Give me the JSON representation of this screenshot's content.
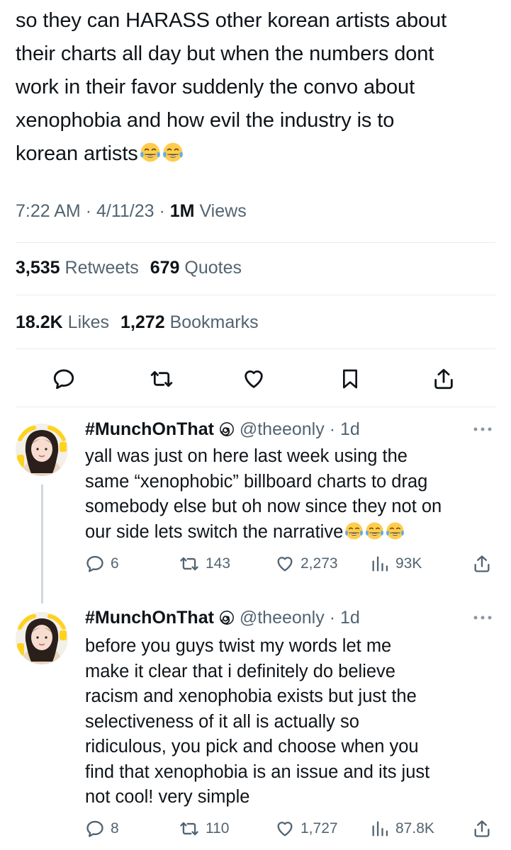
{
  "main_tweet": {
    "text": "so they can HARASS other korean artists about\ntheir charts all day but when the numbers dont\nwork in their favor suddenly the convo about\nxenophobia and how evil the industry is to\nkorean artists",
    "time": "7:22 AM",
    "date": "4/11/23",
    "views_count": "1M",
    "views_label": "Views",
    "retweets_count": "3,535",
    "retweets_label": "Retweets",
    "quotes_count": "679",
    "quotes_label": "Quotes",
    "likes_count": "18.2K",
    "likes_label": "Likes",
    "bookmarks_count": "1,272",
    "bookmarks_label": "Bookmarks",
    "actions": [
      "reply-icon",
      "retweet-icon",
      "like-icon",
      "bookmark-icon",
      "share-icon"
    ]
  },
  "replies": [
    {
      "name": "#MunchOnThat",
      "handle": "@theeonly",
      "age": "1d",
      "text": "yall was just on here last week using the\nsame “xenophobic” billboard charts to drag\nsomebody else but oh now since they not on\nour side lets switch the narrative",
      "replies_count": "6",
      "retweets_count": "143",
      "likes_count": "2,273",
      "views_count": "93K"
    },
    {
      "name": "#MunchOnThat",
      "handle": "@theeonly",
      "age": "1d",
      "text": "before you guys twist my words let me\nmake it clear that i definitely do believe\nracism and xenophobia exists but just the\nselectiveness of it all is actually so\nridiculous, you pick and choose when you\nfind that xenophobia is an issue and its just\nnot cool! very simple",
      "replies_count": "8",
      "retweets_count": "110",
      "likes_count": "1,727",
      "views_count": "87.8K"
    }
  ],
  "colors": {
    "text": "#0f1419",
    "secondary": "#536471",
    "divider": "#e6ecf0",
    "emoji_face": "#ffcc4d",
    "emoji_tear": "#5dadec"
  }
}
